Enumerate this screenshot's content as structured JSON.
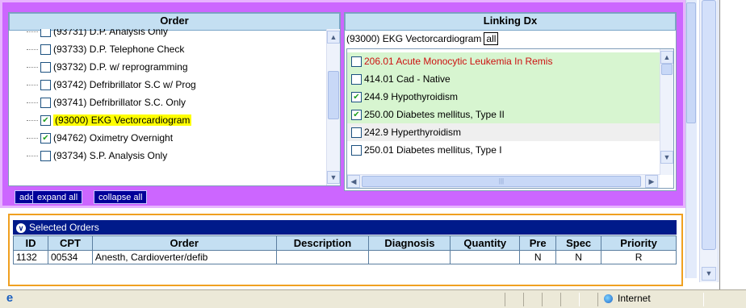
{
  "order_panel": {
    "header": "Order",
    "items": [
      {
        "label": "(93731) D.P. Analysis Only",
        "checked": false,
        "highlight": false
      },
      {
        "label": "(93733) D.P. Telephone Check",
        "checked": false,
        "highlight": false
      },
      {
        "label": "(93732) D.P. w/ reprogramming",
        "checked": false,
        "highlight": false
      },
      {
        "label": "(93742) Defribrillator S.C w/ Prog",
        "checked": false,
        "highlight": false
      },
      {
        "label": "(93741) Defribrillator S.C. Only",
        "checked": false,
        "highlight": false
      },
      {
        "label": "(93000) EKG Vectorcardiogram",
        "checked": true,
        "highlight": true
      },
      {
        "label": "(94762) Oximetry Overnight",
        "checked": true,
        "highlight": false
      },
      {
        "label": "(93734) S.P. Analysis Only",
        "checked": false,
        "highlight": false
      }
    ]
  },
  "linking_panel": {
    "header": "Linking Dx",
    "selected_order": "(93000) EKG Vectorcardiogram",
    "all_label": "all",
    "items": [
      {
        "label": "206.01 Acute Monocytic Leukemia In Remis",
        "checked": false,
        "style": "green",
        "red": true
      },
      {
        "label": "414.01 Cad - Native",
        "checked": false,
        "style": "green",
        "red": false
      },
      {
        "label": "244.9 Hypothyroidism",
        "checked": true,
        "style": "green",
        "red": false
      },
      {
        "label": "250.00 Diabetes mellitus, Type II",
        "checked": true,
        "style": "green",
        "red": false
      },
      {
        "label": "242.9 Hyperthyroidism",
        "checked": false,
        "style": "gray",
        "red": false
      },
      {
        "label": "250.01 Diabetes mellitus, Type I",
        "checked": false,
        "style": "white",
        "red": false
      }
    ]
  },
  "buttons": {
    "add": "add",
    "expand_all": "expand all",
    "collapse_all": "collapse all"
  },
  "selected_orders": {
    "title": "Selected Orders",
    "columns": [
      "ID",
      "CPT",
      "Order",
      "Description",
      "Diagnosis",
      "Quantity",
      "Pre",
      "Spec",
      "Priority"
    ],
    "rows": [
      [
        "1132",
        "00534",
        "Anesth, Cardioverter/defib",
        "",
        "",
        "",
        "N",
        "N",
        "R"
      ]
    ]
  },
  "status_bar": {
    "zone": "Internet"
  },
  "colors": {
    "panel_purple": "#cc66ff",
    "header_blue": "#c4dff2",
    "button_navy": "#000099",
    "selected_bar": "#001a8a",
    "panel_orange_border": "#f0a020",
    "dx_green": "#d7f5d0",
    "highlight_yellow": "#ffff00",
    "dx_red_text": "#cc1111"
  },
  "icons": {
    "collapse": "chevron-circle-icon",
    "scroll_up": "arrow-up-icon",
    "scroll_down": "arrow-down-icon",
    "scroll_left": "arrow-left-icon",
    "scroll_right": "arrow-right-icon",
    "browser": "ie-icon",
    "zone": "globe-icon"
  }
}
